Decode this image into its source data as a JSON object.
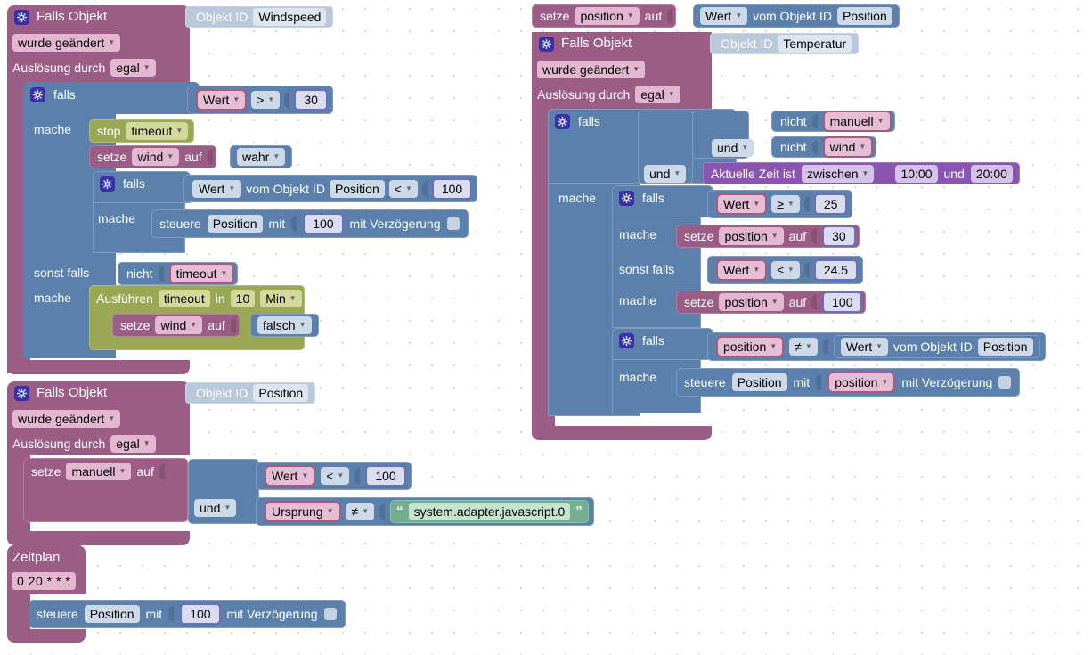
{
  "workspace": {
    "title": "Blockly Workspace",
    "grid_spacing": 25,
    "colors": {
      "event": "#9b5d85",
      "control": "#5b80ac",
      "timeout": "#9aa856",
      "time": "#8a55b0",
      "object_id": "#b9c8da",
      "number": "#6b6fb5",
      "text": "#73ae8e"
    }
  },
  "script1": {
    "hat": {
      "title": "Falls Objekt",
      "objekt_id_label": "Objekt ID",
      "objekt_id_value": "Windspeed",
      "trigger_mode": "wurde geändert",
      "source_label": "Auslösung durch",
      "source_value": "egal"
    },
    "if1": {
      "if_label": "falls",
      "do_label": "mache",
      "else_if_label": "sonst falls",
      "else_do_label": "mache",
      "cond_left": "Wert",
      "cond_op": ">",
      "cond_right": "30",
      "stop_label": "stop",
      "stop_target": "timeout",
      "set_label": "setze",
      "set_var": "wind",
      "set_auf": "auf",
      "set_value": "wahr",
      "inner_if_label": "falls",
      "inner_do_label": "mache",
      "inner_cond_left": "Wert",
      "inner_cond_from": "vom Objekt ID",
      "inner_cond_obj": "Position",
      "inner_cond_op": "<",
      "inner_cond_right": "100",
      "steuere_label": "steuere",
      "steuere_obj": "Position",
      "steuere_mit": "mit",
      "steuere_value": "100",
      "steuere_delay": "mit Verzögerung",
      "else_not": "nicht",
      "else_var": "timeout",
      "exec_label": "Ausführen",
      "exec_name": "timeout",
      "exec_in": "in",
      "exec_amount": "10",
      "exec_unit": "Min",
      "exec_set_label": "setze",
      "exec_set_var": "wind",
      "exec_set_auf": "auf",
      "exec_set_value": "falsch"
    }
  },
  "script2": {
    "hat": {
      "title": "Falls Objekt",
      "objekt_id_label": "Objekt ID",
      "objekt_id_value": "Position",
      "trigger_mode": "wurde geändert",
      "source_label": "Auslösung durch",
      "source_value": "egal"
    },
    "body": {
      "set_label": "setze",
      "set_var": "manuell",
      "set_auf": "auf",
      "and_op": "und",
      "cond1_left": "Wert",
      "cond1_op": "<",
      "cond1_right": "100",
      "cond2_left": "Ursprung",
      "cond2_op": "≠",
      "cond2_right": "system.adapter.javascript.0"
    }
  },
  "script3": {
    "hat": {
      "title": "Zeitplan",
      "cron": "0 20 * * *"
    },
    "body": {
      "steuere_label": "steuere",
      "steuere_obj": "Position",
      "steuere_mit": "mit",
      "steuere_value": "100",
      "steuere_delay": "mit Verzögerung"
    }
  },
  "script4": {
    "top_set": {
      "set_label": "setze",
      "set_var": "position",
      "set_auf": "auf",
      "value_left": "Wert",
      "value_from": "vom Objekt ID",
      "value_obj": "Position"
    },
    "hat": {
      "title": "Falls Objekt",
      "objekt_id_label": "Objekt ID",
      "objekt_id_value": "Temperatur",
      "trigger_mode": "wurde geändert",
      "source_label": "Auslösung durch",
      "source_value": "egal"
    },
    "outer_if": {
      "if_label": "falls",
      "do_label": "mache",
      "not1": "nicht",
      "var1": "manuell",
      "and1": "und",
      "not2": "nicht",
      "var2": "wind",
      "and2": "und",
      "time_label": "Aktuelle Zeit ist",
      "time_op": "zwischen",
      "time_from": "10:00",
      "time_und": "und",
      "time_to": "20:00"
    },
    "inner_if1": {
      "if_label": "falls",
      "do_label": "mache",
      "else_if_label": "sonst falls",
      "else_do_label": "mache",
      "cond1_left": "Wert",
      "cond1_op": "≥",
      "cond1_right": "25",
      "then_set_label": "setze",
      "then_set_var": "position",
      "then_set_auf": "auf",
      "then_set_value": "30",
      "cond2_left": "Wert",
      "cond2_op": "≤",
      "cond2_right": "24.5",
      "else_set_label": "setze",
      "else_set_var": "position",
      "else_set_auf": "auf",
      "else_set_value": "100"
    },
    "inner_if2": {
      "if_label": "falls",
      "do_label": "mache",
      "cond_left": "position",
      "cond_op": "≠",
      "cond_right_left": "Wert",
      "cond_right_from": "vom Objekt ID",
      "cond_right_obj": "Position",
      "steuere_label": "steuere",
      "steuere_obj": "Position",
      "steuere_mit": "mit",
      "steuere_value": "position",
      "steuere_delay": "mit Verzögerung"
    }
  }
}
